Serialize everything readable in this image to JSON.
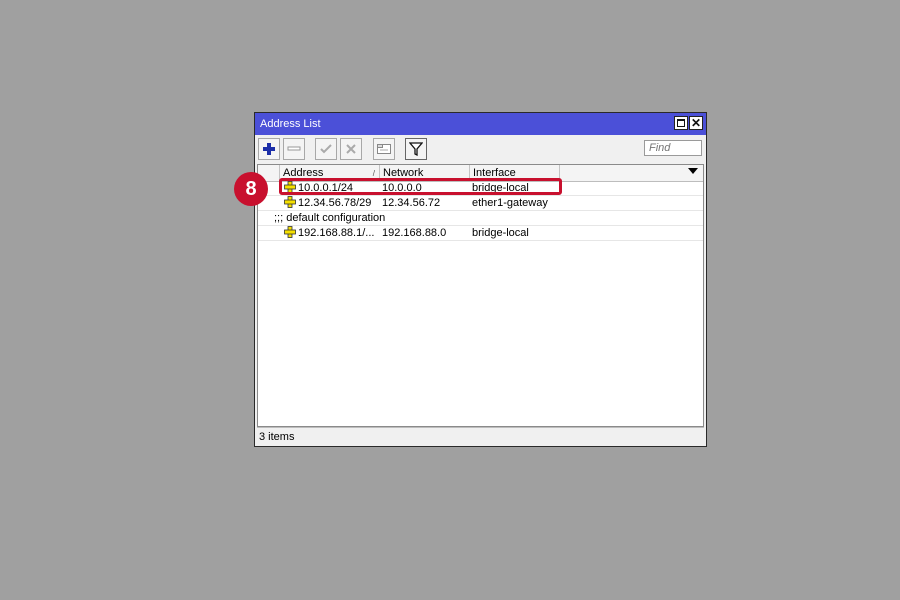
{
  "window": {
    "title": "Address List"
  },
  "toolbar": {
    "add": "add-icon",
    "remove": "remove-icon",
    "enable": "check-icon",
    "disable": "x-icon",
    "comment": "comment-icon",
    "filter": "filter-icon",
    "find_placeholder": "Find"
  },
  "table": {
    "columns": [
      "Address",
      "Network",
      "Interface"
    ],
    "sort_indicator": "/",
    "rows": [
      {
        "address": "10.0.0.1/24",
        "network": "10.0.0.0",
        "interface": "bridge-local"
      },
      {
        "address": "12.34.56.78/29",
        "network": "12.34.56.72",
        "interface": "ether1-gateway"
      },
      {
        "comment": ";;; default configuration"
      },
      {
        "address": "192.168.88.1/...",
        "network": "192.168.88.0",
        "interface": "bridge-local"
      }
    ]
  },
  "status": {
    "items": "3 items"
  },
  "annotation": {
    "step": "8",
    "color": "#c8102e"
  },
  "colors": {
    "titlebar": "#4b50d8",
    "background": "#a0a0a0"
  }
}
